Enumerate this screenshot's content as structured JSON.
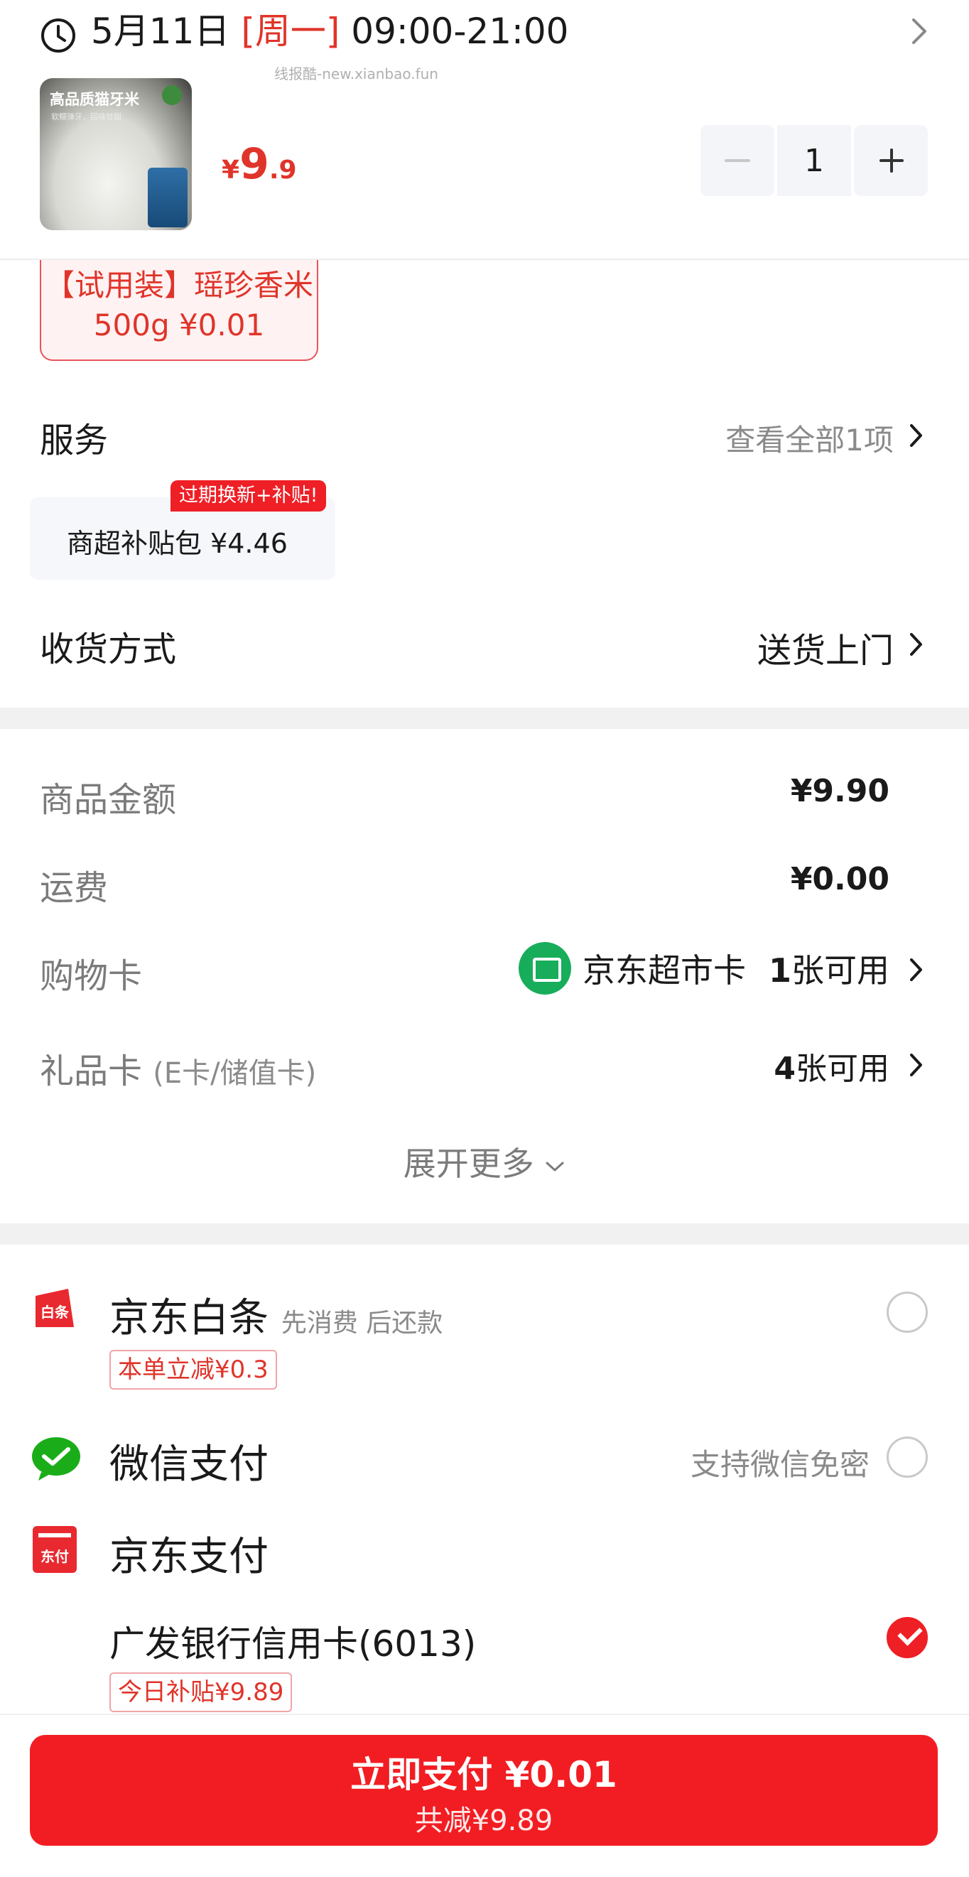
{
  "delivery": {
    "date": "5月11日",
    "weekday": "[周一]",
    "time": "09:00-21:00",
    "watermark": "线报酷-new.xianbao.fun"
  },
  "product": {
    "image_title": "高品质猫牙米",
    "image_subtitle": "软糯弹牙，回味甘甜",
    "price_currency": "¥",
    "price_int": "9",
    "price_dec": ".9",
    "quantity": "1",
    "trial_tag": "【试用装】瑶珍香米500g ¥0.01"
  },
  "service": {
    "title": "服务",
    "view_all": "查看全部1项",
    "card_label": "商超补贴包  ¥4.46",
    "card_badge": "过期换新+补贴!"
  },
  "delivery_method": {
    "title": "收货方式",
    "value": "送货上门"
  },
  "amounts": {
    "goods_label": "商品金额",
    "goods_value": "¥9.90",
    "shipping_label": "运费",
    "shipping_value": "¥0.00",
    "shopping_card_label": "购物卡",
    "shopping_card_name": "京东超市卡",
    "shopping_card_count_num": "1",
    "shopping_card_count_text": "张可用",
    "gift_card_label": "礼品卡",
    "gift_card_sub": "(E卡/储值卡)",
    "gift_card_count_num": "4",
    "gift_card_count_text": "张可用",
    "expand": "展开更多"
  },
  "payment": {
    "baitiao_name": "京东白条",
    "baitiao_sub": "先消费 后还款",
    "baitiao_promo": "本单立减¥0.3",
    "baitiao_icon_text": "白条",
    "wechat_name": "微信支付",
    "wechat_note": "支持微信免密",
    "jdpay_name": "京东支付",
    "jdpay_icon_text": "东付",
    "bank_name": "广发银行信用卡(6013)",
    "bank_promo": "今日补贴¥9.89"
  },
  "checkout": {
    "pay_label": "立即支付 ¥0.01",
    "discount_label": "共减¥9.89"
  },
  "colors": {
    "accent": "#ef1f26",
    "price": "#e0342a",
    "wechat": "#1aad19",
    "card_green": "#17ad5b"
  }
}
